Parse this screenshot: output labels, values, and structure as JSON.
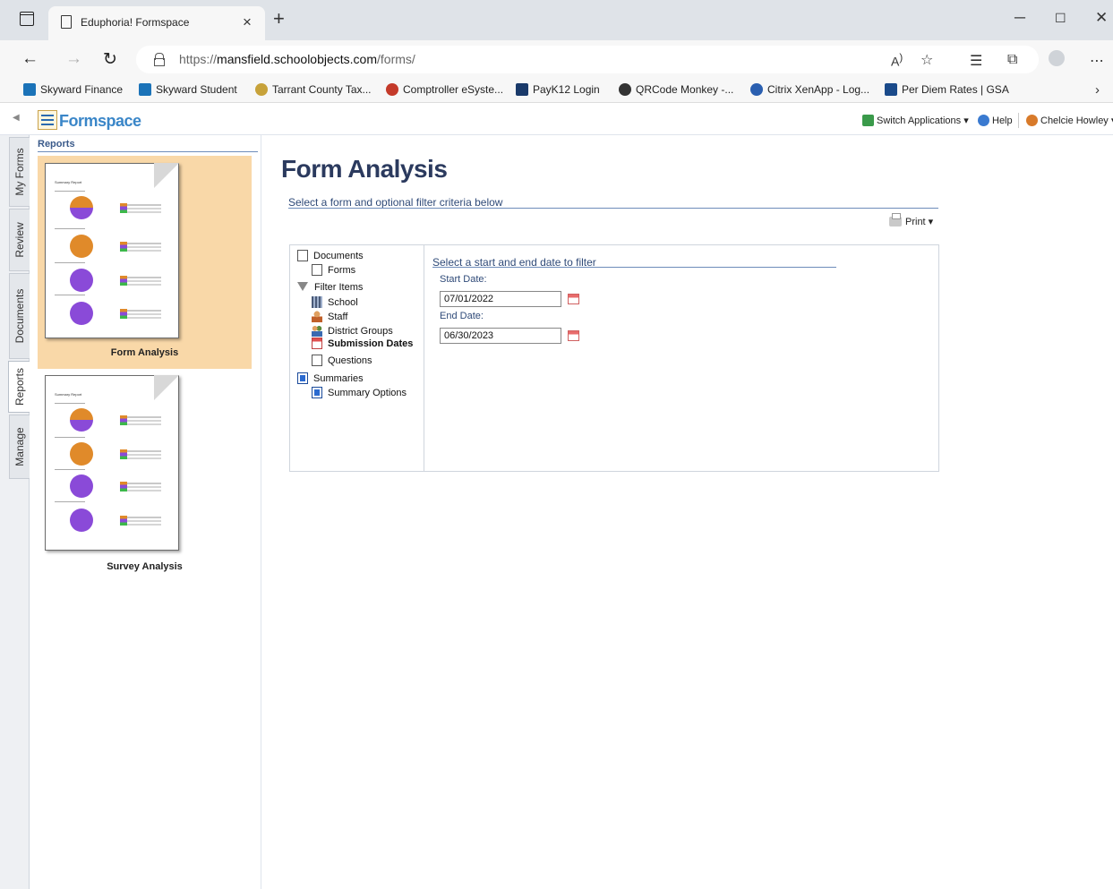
{
  "browser": {
    "tab_title": "Eduphoria! Formspace",
    "url_prefix": "https://",
    "url_host": "mansfield.schoolobjects.com",
    "url_path": "/forms/",
    "bookmarks": [
      {
        "label": "Skyward Finance",
        "icon": "skyward-icon",
        "color": "#1b73b8"
      },
      {
        "label": "Skyward Student",
        "icon": "skyward-icon",
        "color": "#1b73b8"
      },
      {
        "label": "Tarrant County Tax...",
        "icon": "county-seal-icon",
        "color": "#c7a23a"
      },
      {
        "label": "Comptroller eSyste...",
        "icon": "comptroller-icon",
        "color": "#c43a2a"
      },
      {
        "label": "PayK12 Login",
        "icon": "payk12-icon",
        "color": "#1a3a6a"
      },
      {
        "label": "QRCode Monkey -...",
        "icon": "qrcode-monkey-icon",
        "color": "#333333"
      },
      {
        "label": "Citrix XenApp - Log...",
        "icon": "citrix-icon",
        "color": "#2a5fb0"
      },
      {
        "label": "Per Diem Rates | GSA",
        "icon": "gsa-icon",
        "color": "#1a4a8a"
      }
    ]
  },
  "app": {
    "logo_text": "Formspace",
    "header_links": {
      "switch_applications": "Switch Applications ▾",
      "help": "Help",
      "user": "Chelcie Howley"
    },
    "side_tabs": [
      "My Forms",
      "Review",
      "Documents",
      "Reports",
      "Manage"
    ],
    "active_side_tab": "Reports",
    "reports_panel": {
      "title": "Reports",
      "doc_title": "Summary Report",
      "items": [
        {
          "label": "Form Analysis",
          "selected": true
        },
        {
          "label": "Survey Analysis",
          "selected": false
        }
      ]
    }
  },
  "main": {
    "title": "Form Analysis",
    "subtitle": "Select a form and optional filter criteria below",
    "print_label": "Print ▾",
    "tree": {
      "documents": "Documents",
      "forms": "Forms",
      "filter_items": "Filter Items",
      "school": "School",
      "staff": "Staff",
      "district_groups": "District Groups",
      "submission_dates": "Submission Dates",
      "questions": "Questions",
      "summaries": "Summaries",
      "summary_options": "Summary Options"
    },
    "filter": {
      "heading": "Select a start and end date to filter",
      "start_label": "Start Date:",
      "start_value": "07/01/2022",
      "end_label": "End Date:",
      "end_value": "06/30/2023"
    }
  },
  "colors": {
    "accent_blue": "#3a86c8",
    "title_navy": "#2b3a5e",
    "selected_report_bg": "#f9d8a8",
    "pie_orange": "#e08a2a",
    "pie_purple": "#8a4ad8"
  }
}
